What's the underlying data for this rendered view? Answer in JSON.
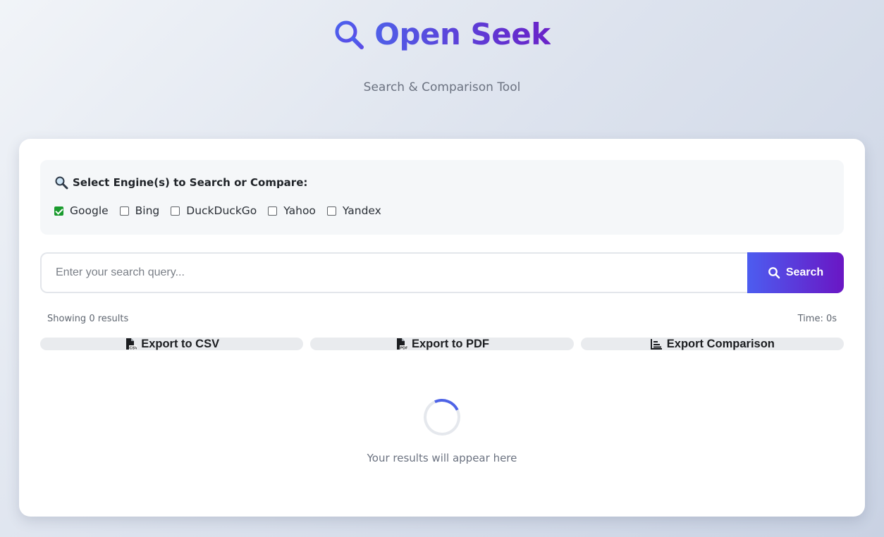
{
  "header": {
    "title": "Open Seek",
    "subtitle": "Search & Comparison Tool",
    "icon": "search-icon"
  },
  "engines": {
    "heading": "Select Engine(s) to Search or Compare:",
    "heading_icon": "magnifier-icon",
    "items": [
      {
        "label": "Google",
        "checked": true
      },
      {
        "label": "Bing",
        "checked": false
      },
      {
        "label": "DuckDuckGo",
        "checked": false
      },
      {
        "label": "Yahoo",
        "checked": false
      },
      {
        "label": "Yandex",
        "checked": false
      }
    ]
  },
  "search": {
    "value": "",
    "placeholder": "Enter your search query...",
    "button_label": "Search"
  },
  "results_meta": {
    "count_text": "Showing 0 results",
    "time_text": "Time: 0s"
  },
  "exports": {
    "csv_label": "Export to CSV",
    "pdf_label": "Export to PDF",
    "comparison_label": "Export Comparison"
  },
  "empty_state": {
    "message": "Your results will appear here"
  },
  "colors": {
    "accent_start": "#4c5df0",
    "accent_end": "#6a16c4",
    "checkbox_checked": "#1a9b2e"
  }
}
